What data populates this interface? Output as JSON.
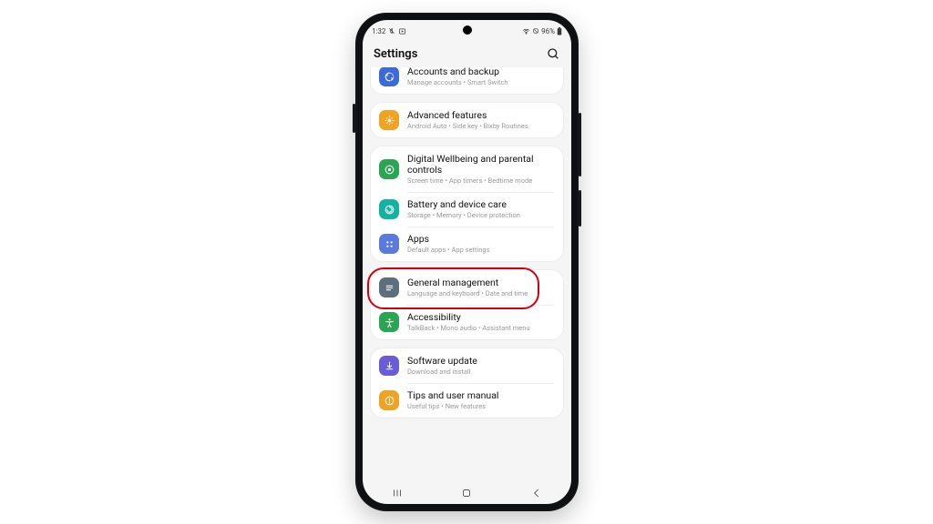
{
  "status": {
    "time": "1:32",
    "battery": "96%"
  },
  "header": {
    "title": "Settings"
  },
  "groups": [
    {
      "rows": [
        {
          "id": "accounts",
          "label": "Accounts and backup",
          "sub": "Manage accounts  •  Smart Switch",
          "color": "#3b6bd6"
        }
      ]
    },
    {
      "rows": [
        {
          "id": "advanced",
          "label": "Advanced features",
          "sub": "Android Auto  •  Side key  •  Bixby Routines",
          "color": "#f0a323"
        }
      ]
    },
    {
      "rows": [
        {
          "id": "wellbeing",
          "label": "Digital Wellbeing and parental controls",
          "sub": "Screen time  •  App timers  •  Bedtime mode",
          "color": "#2aa653"
        },
        {
          "id": "devicecare",
          "label": "Battery and device care",
          "sub": "Storage  •  Memory  •  Device protection",
          "color": "#13b3a3"
        },
        {
          "id": "apps",
          "label": "Apps",
          "sub": "Default apps  •  App settings",
          "color": "#5b7bdc"
        }
      ]
    },
    {
      "rows": [
        {
          "id": "general",
          "label": "General management",
          "sub": "Language and keyboard  •  Date and time",
          "color": "#5d6e7e"
        },
        {
          "id": "accessibility",
          "label": "Accessibility",
          "sub": "TalkBack  •  Mono audio  •  Assistant menu",
          "color": "#2aa653"
        }
      ]
    },
    {
      "rows": [
        {
          "id": "swupdate",
          "label": "Software update",
          "sub": "Download and install",
          "color": "#6a5bd6"
        },
        {
          "id": "tips",
          "label": "Tips and user manual",
          "sub": "Useful tips  •  New features",
          "color": "#f0a323"
        }
      ]
    }
  ],
  "highlight_row": "general"
}
